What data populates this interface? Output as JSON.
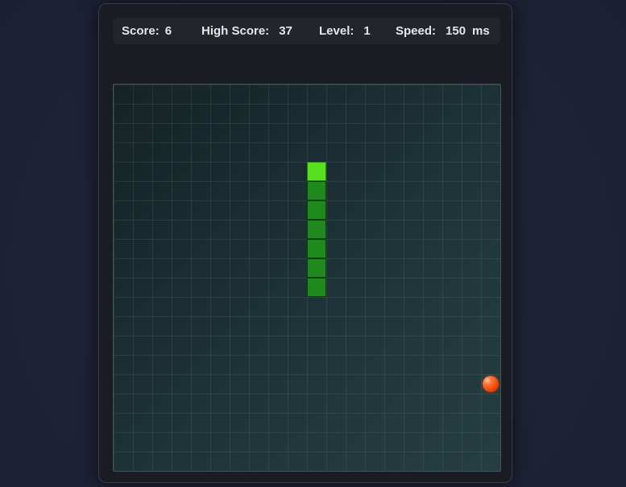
{
  "stats": {
    "score_label": "Score:",
    "score_value": "6",
    "high_score_label": "High Score:",
    "high_score_value": "37",
    "level_label": "Level:",
    "level_value": "1",
    "speed_label": "Speed:",
    "speed_value": "150",
    "speed_unit": "ms"
  },
  "game": {
    "cols": 20,
    "rows": 20,
    "direction": "up",
    "snake": [
      {
        "col": 10,
        "row": 4
      },
      {
        "col": 10,
        "row": 5
      },
      {
        "col": 10,
        "row": 6
      },
      {
        "col": 10,
        "row": 7
      },
      {
        "col": 10,
        "row": 8
      },
      {
        "col": 10,
        "row": 9
      },
      {
        "col": 10,
        "row": 10
      }
    ],
    "food": {
      "col": 19,
      "row": 15
    }
  },
  "colors": {
    "snake_head": "#58e01e",
    "snake_body": "#1e8a1e",
    "food": "#f04a0a",
    "board": "#1a2d30"
  }
}
